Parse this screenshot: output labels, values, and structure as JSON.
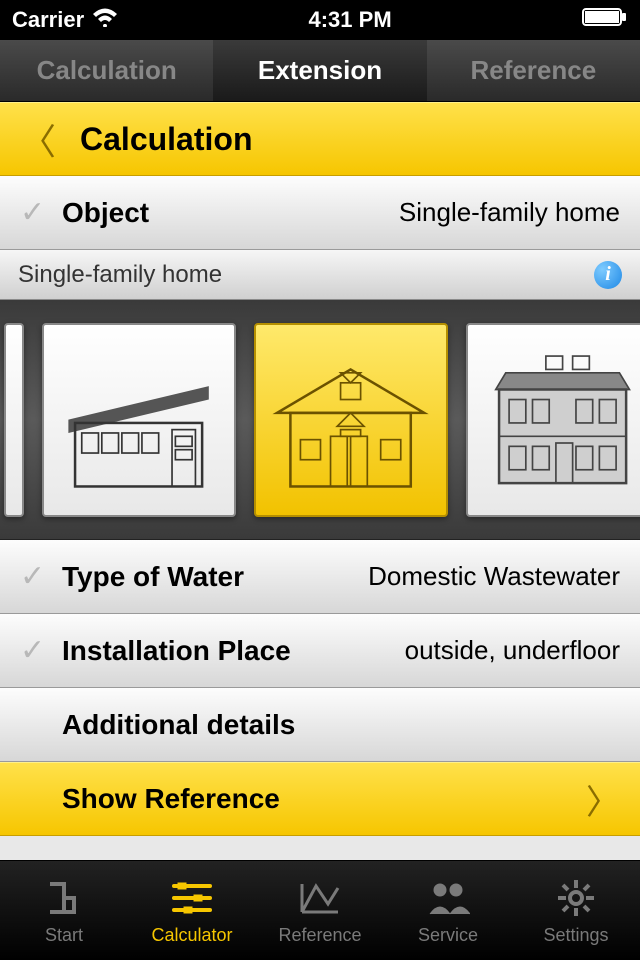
{
  "status": {
    "carrier": "Carrier",
    "time": "4:31 PM"
  },
  "topTabs": {
    "calculation": "Calculation",
    "extension": "Extension",
    "reference": "Reference"
  },
  "header": {
    "title": "Calculation"
  },
  "rows": {
    "object": {
      "label": "Object",
      "value": "Single-family home"
    },
    "type": {
      "label": "Type of Water",
      "value": "Domestic Wastewater"
    },
    "place": {
      "label": "Installation Place",
      "value": "outside, underfloor"
    },
    "details": {
      "label": "Additional details"
    },
    "showRef": {
      "label": "Show Reference"
    }
  },
  "subheader": {
    "text": "Single-family home"
  },
  "carousel": {
    "items": [
      {
        "name": "modern-house",
        "selected": false
      },
      {
        "name": "single-family-home",
        "selected": true
      },
      {
        "name": "large-house",
        "selected": false
      }
    ]
  },
  "tabbar": {
    "start": "Start",
    "calculator": "Calculator",
    "reference": "Reference",
    "service": "Service",
    "settings": "Settings"
  },
  "colors": {
    "accent": "#f6c600"
  }
}
